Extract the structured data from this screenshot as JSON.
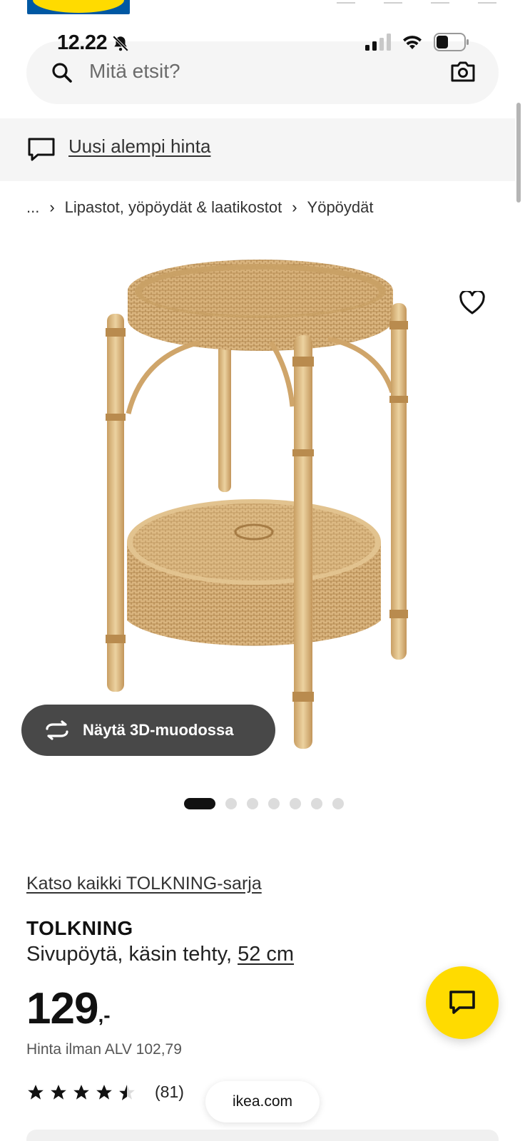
{
  "status_bar": {
    "time": "12.22",
    "icons": [
      "bell-slash-icon",
      "signal-icon",
      "wifi-icon",
      "battery-icon"
    ]
  },
  "search": {
    "placeholder": "Mitä etsit?"
  },
  "promo": {
    "label": "Uusi alempi hinta"
  },
  "breadcrumb": {
    "items": [
      "...",
      "Lipastot, yöpöydät & laatikostot",
      "Yöpöydät"
    ]
  },
  "gallery": {
    "view_3d_label": "Näytä 3D-muodossa",
    "total_images": 7,
    "active_index": 1
  },
  "product": {
    "series_link": "Katso kaikki TOLKNING-sarja",
    "name": "TOLKNING",
    "description": "Sivupöytä, käsin tehty, ",
    "size": "52 cm",
    "price_main": "129",
    "price_suffix": ",-",
    "vat_text": "Hinta ilman ALV 102,79",
    "rating": 4.5,
    "review_count": "(81)"
  },
  "browser": {
    "domain": "ikea.com"
  },
  "colors": {
    "ikea_yellow": "#ffdb00",
    "ikea_blue": "#0058a3",
    "dark_button": "#484848"
  }
}
